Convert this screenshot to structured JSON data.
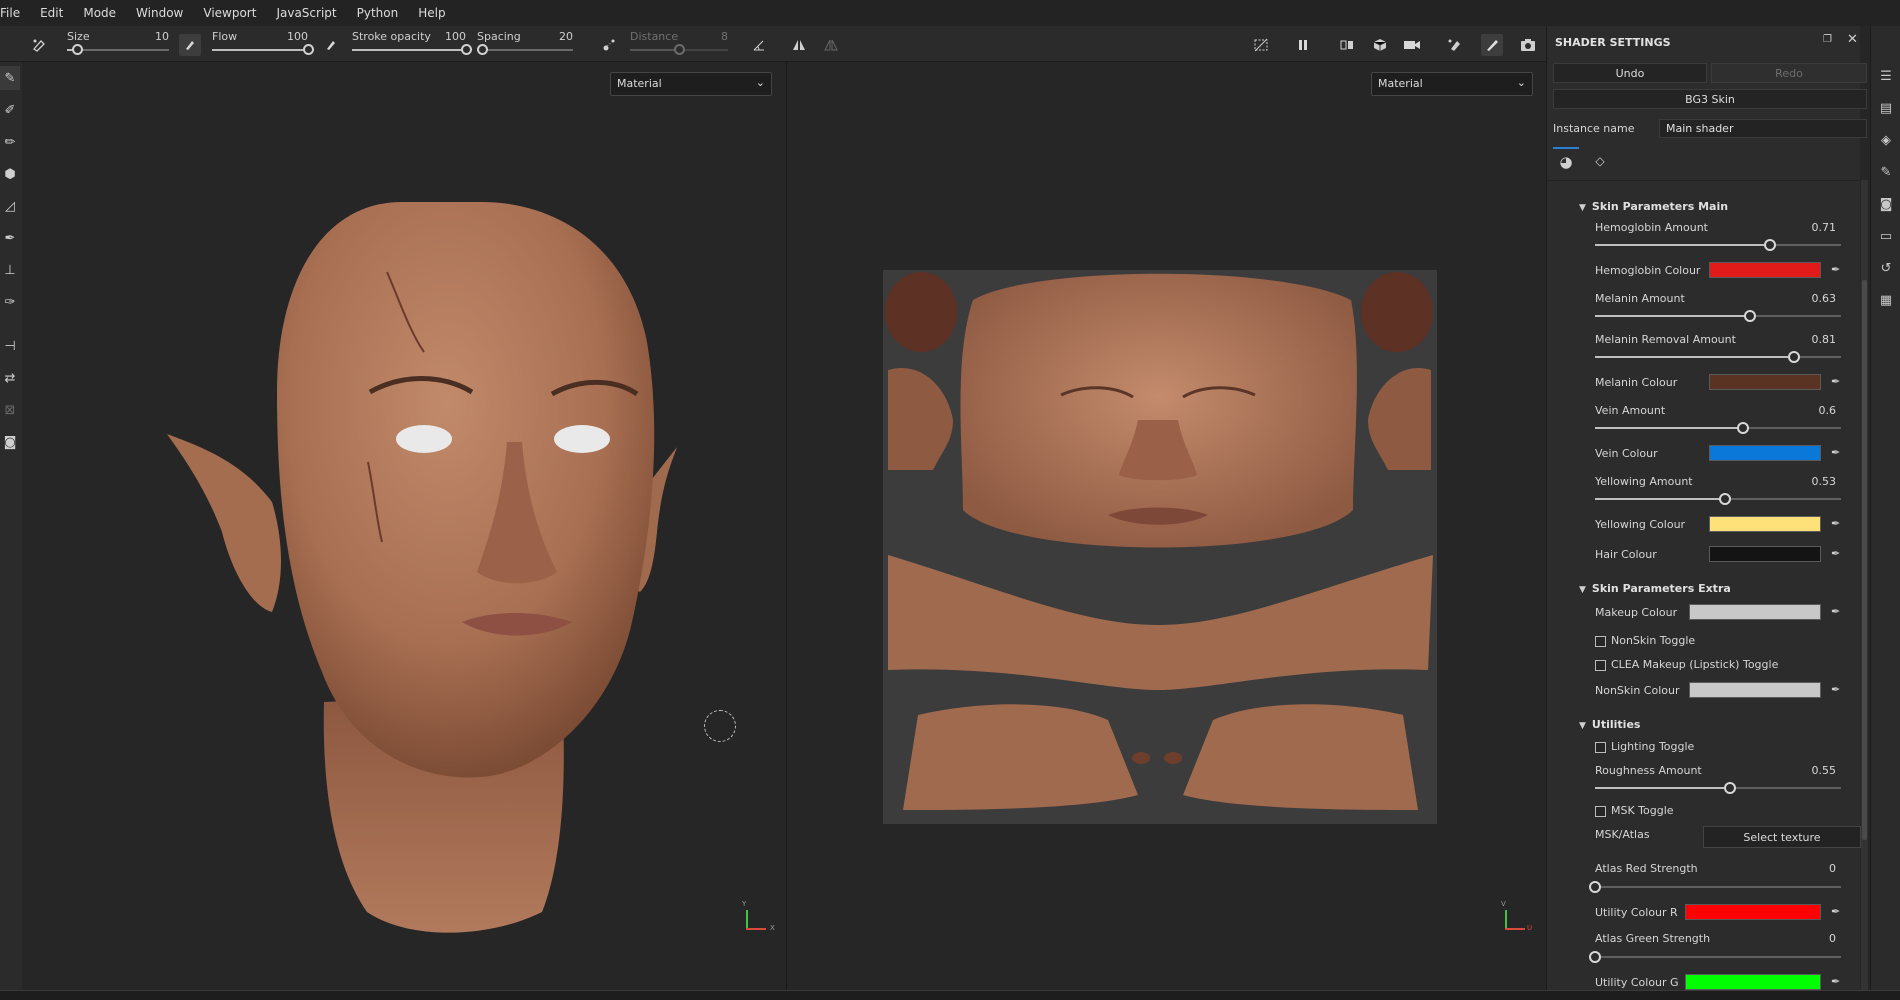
{
  "menu": [
    "File",
    "Edit",
    "Mode",
    "Window",
    "Viewport",
    "JavaScript",
    "Python",
    "Help"
  ],
  "toolbar": {
    "size": {
      "label": "Size",
      "value": "10",
      "fraction": 0.1
    },
    "flow": {
      "label": "Flow",
      "value": "100",
      "fraction": 1.0
    },
    "stroke_opacity": {
      "label": "Stroke opacity",
      "value": "100",
      "fraction": 1.0
    },
    "spacing": {
      "label": "Spacing",
      "value": "20",
      "fraction": 0.05
    },
    "distance": {
      "label": "Distance",
      "value": "8",
      "fraction": 0.5
    }
  },
  "viewport_left": {
    "dropdown": "Material"
  },
  "viewport_right": {
    "dropdown": "Material"
  },
  "panel": {
    "title": "SHADER SETTINGS",
    "undo": "Undo",
    "redo": "Redo",
    "shader_name": "BG3 Skin",
    "instance_label": "Instance name",
    "instance_value": "Main shader",
    "sections": {
      "main": "Skin Parameters Main",
      "extra": "Skin Parameters Extra",
      "utilities": "Utilities"
    },
    "hemoglobin_amount": {
      "label": "Hemoglobin Amount",
      "value": "0.71",
      "fraction": 0.71
    },
    "hemoglobin_colour": {
      "label": "Hemoglobin Colour",
      "color": "#e11a1a"
    },
    "melanin_amount": {
      "label": "Melanin Amount",
      "value": "0.63",
      "fraction": 0.63
    },
    "melanin_removal": {
      "label": "Melanin Removal Amount",
      "value": "0.81",
      "fraction": 0.81
    },
    "melanin_colour": {
      "label": "Melanin Colour",
      "color": "#5a3322"
    },
    "vein_amount": {
      "label": "Vein Amount",
      "value": "0.6",
      "fraction": 0.6
    },
    "vein_colour": {
      "label": "Vein Colour",
      "color": "#0a78d8"
    },
    "yellowing_amount": {
      "label": "Yellowing Amount",
      "value": "0.53",
      "fraction": 0.53
    },
    "yellowing_colour": {
      "label": "Yellowing Colour",
      "color": "#ffe17a"
    },
    "hair_colour": {
      "label": "Hair Colour",
      "color": "#141414"
    },
    "makeup_colour": {
      "label": "Makeup Colour",
      "color": "#c8c8c8"
    },
    "nonskin_toggle": "NonSkin Toggle",
    "clea_toggle": "CLEA Makeup (Lipstick) Toggle",
    "nonskin_colour": {
      "label": "NonSkin Colour",
      "color": "#c8c8c8"
    },
    "lighting_toggle": "Lighting Toggle",
    "roughness_amount": {
      "label": "Roughness Amount",
      "value": "0.55",
      "fraction": 0.55
    },
    "msk_toggle": "MSK Toggle",
    "msk_atlas": {
      "label": "MSK/Atlas",
      "button": "Select texture"
    },
    "atlas_red": {
      "label": "Atlas Red Strength",
      "value": "0",
      "fraction": 0
    },
    "utility_r": {
      "label": "Utility Colour R",
      "color": "#ff0000"
    },
    "atlas_green": {
      "label": "Atlas Green Strength",
      "value": "0",
      "fraction": 0
    },
    "utility_g": {
      "label": "Utility Colour G",
      "color": "#00ff00"
    }
  },
  "axes": {
    "left": {
      "y": "Y",
      "x": "X"
    },
    "right": {
      "v": "V",
      "u": "U"
    }
  },
  "icons": {
    "eyedropper": "eyedropper-icon",
    "brush": "brush-icon",
    "camera": "camera-icon",
    "pause": "pause-icon"
  }
}
